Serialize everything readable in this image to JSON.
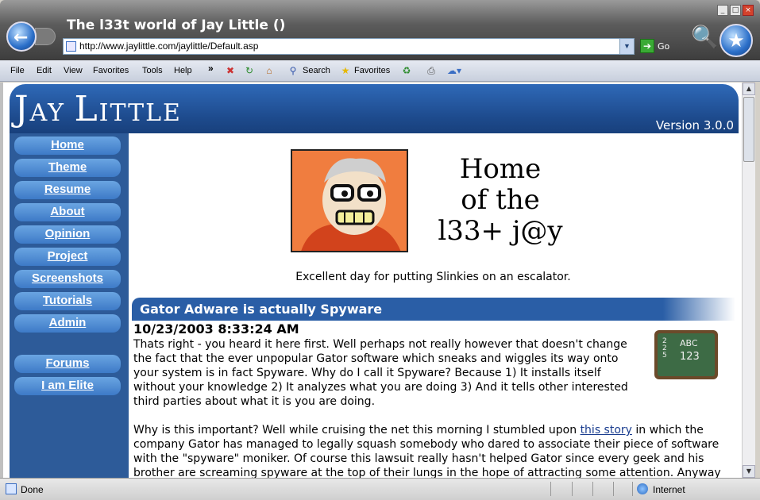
{
  "window": {
    "title": "The l33t world of Jay Little ()",
    "address": "http://www.jaylittle.com/jaylittle/Default.asp",
    "go_label": "Go"
  },
  "menubar": {
    "items": [
      {
        "label": "File"
      },
      {
        "label": "Edit"
      },
      {
        "label": "View"
      },
      {
        "label": "Favorites"
      },
      {
        "label": "Tools"
      },
      {
        "label": "Help"
      }
    ],
    "search_label": "Search",
    "favorites_label": "Favorites"
  },
  "site": {
    "logo_j": "J",
    "logo_ay": "AY ",
    "logo_l": "L",
    "logo_ittle": "ITTLE",
    "version": "Version 3.0.0",
    "nav": [
      {
        "label": "Home"
      },
      {
        "label": "Theme"
      },
      {
        "label": "Resume"
      },
      {
        "label": "About"
      },
      {
        "label": "Opinion"
      },
      {
        "label": "Project"
      },
      {
        "label": "Screenshots"
      },
      {
        "label": "Tutorials"
      },
      {
        "label": "Admin"
      },
      {
        "label": "Forums"
      },
      {
        "label": "I am Elite"
      }
    ]
  },
  "main": {
    "home_title_1": "Home",
    "home_title_2": "of the",
    "home_title_3": "l33+ j@y",
    "tagline": "Excellent day for putting Slinkies on an escalator.",
    "post": {
      "title": "Gator Adware is actually Spyware",
      "date": "10/23/2003 8:33:24 AM",
      "para1": "Thats right - you heard it here first. Well perhaps not really however that doesn't change the fact that the ever unpopular Gator software which sneaks and wiggles its way onto your system is in fact Spyware. Why do I call it Spyware? Because 1) It installs itself without your knowledge 2) It analyzes what you are doing 3) And it tells other interested third parties about what it is you are doing.",
      "para2_a": "Why is this important? Well while cruising the net this morning I stumbled upon ",
      "para2_link": "this story",
      "para2_b": " in which the company Gator has managed to legally squash somebody who dared to associate their piece of software with the \"spyware\" moniker. Of course this lawsuit really hasn't helped Gator since every geek and his brother are screaming spyware at the top of their lungs in the hope of attracting some attention. Anyway I've decided to send an email to my friends"
    },
    "chalkboard": {
      "line1": "ABC",
      "line2": "123",
      "frac_top": "2",
      "frac_mid": "2",
      "frac_bot": "5"
    }
  },
  "status": {
    "text": "Done",
    "zone": "Internet"
  },
  "colors": {
    "banner": "#1d4a8c",
    "nav_button": "#3d7ac7",
    "link": "#1a3d8f"
  }
}
